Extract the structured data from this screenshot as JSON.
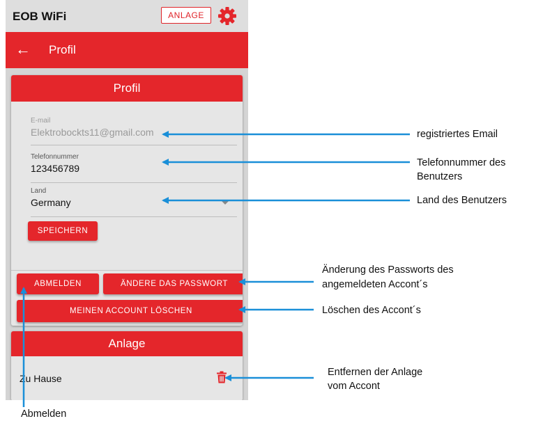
{
  "app": {
    "title": "EOB WiFi",
    "anlage_button": "ANLAGE",
    "gear_icon": "gear-icon",
    "accent_color": "#e4262b"
  },
  "appbar": {
    "back_icon": "arrow-left-icon",
    "title": "Profil"
  },
  "profile_card": {
    "title": "Profil",
    "fields": {
      "email": {
        "label": "E-mail",
        "value": "Elektrobockts11@gmail.com"
      },
      "phone": {
        "label": "Telefonnummer",
        "value": "123456789"
      },
      "country": {
        "label": "Land",
        "value": "Germany"
      }
    },
    "save_button": "SPEICHERN",
    "logout_button": "ABMELDEN",
    "change_password_button": "ÄNDERE DAS PASSWORT",
    "delete_account_button": "MEINEN ACCOUNT LÖSCHEN"
  },
  "anlage_card": {
    "title": "Anlage",
    "items": [
      {
        "name": "Zu Hause",
        "icon": "trash-icon"
      }
    ]
  },
  "annotations": {
    "email": "registriertes Email",
    "phone_line1": "Telefonnummer des",
    "phone_line2": "Benutzers",
    "country": "Land des Benutzers",
    "password_line1": "Änderung des Passworts des",
    "password_line2": "angemeldeten Accont´s",
    "delete": "Löschen des Accont´s",
    "remove_line1": "Entfernen der Anlage",
    "remove_line2": "vom Accont",
    "logout": "Abmelden"
  }
}
